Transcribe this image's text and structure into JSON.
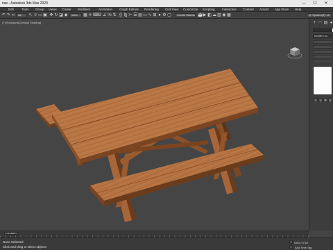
{
  "window": {
    "title": "nax - Autodesk 3ds Max 2020",
    "minimize": "—",
    "maximize": "☐",
    "close": "✕"
  },
  "menu": {
    "items": [
      "Edit",
      "Tools",
      "Group",
      "Views",
      "Create",
      "Modifiers",
      "Animation",
      "Graph Editors",
      "Rendering",
      "Civil View",
      "Customize",
      "Scripting",
      "Interactive",
      "Content",
      "Arnold",
      "App Store",
      "Help"
    ]
  },
  "toolbar": {
    "filter_select": "All",
    "viewport_coord_select": "View",
    "selection_set": "Create Selection Se",
    "workspace_select": "Q: System(2): ch"
  },
  "viewport": {
    "label": "[+] [Standard] [Default Shading]"
  },
  "command_panel": {
    "modifier_list": "Modifier List"
  },
  "timeline": {
    "slider_text": "0 / 100"
  },
  "status": {
    "selection": "None Selected",
    "prompt": "Click-and-drag to select objects",
    "grid": "Grid = 0'10\"",
    "time_tag": "Add Time Tag"
  },
  "colors": {
    "wood_light": "#b97845",
    "wood_mid": "#a9693a",
    "wood_dark": "#7a4521",
    "viewport_bg": "#454545"
  }
}
